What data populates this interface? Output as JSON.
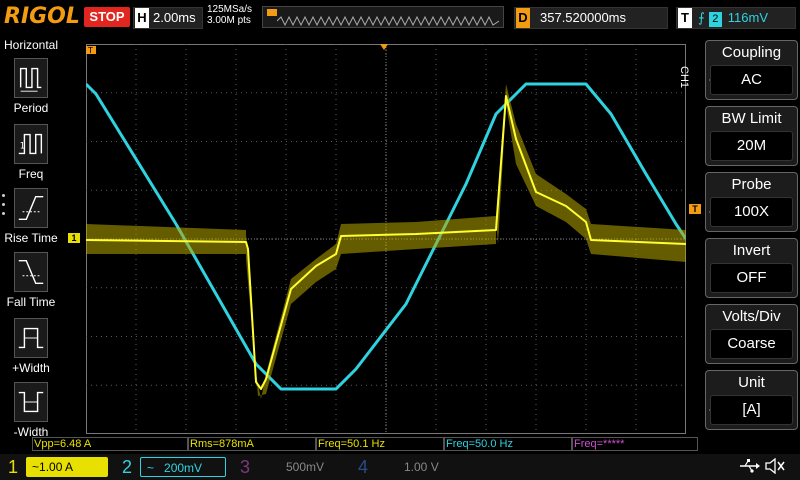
{
  "brand": {
    "logo": "RIGOL"
  },
  "topbar": {
    "run_state": "STOP",
    "horizontal_letter": "H",
    "timebase": "2.00ms",
    "sample_rate": "125MSa/s",
    "mem_depth": "3.00M pts",
    "delay_letter": "D",
    "delay_value": "357.520000ms",
    "trigger_letter": "T",
    "trigger_slope_icon": "rising-edge-icon",
    "trigger_source": "2",
    "trigger_level": "116mV"
  },
  "left_panel": {
    "title": "Horizontal",
    "items": [
      {
        "label": "Period",
        "icon": "period-measure-icon"
      },
      {
        "label": "Freq",
        "icon": "freq-measure-icon"
      },
      {
        "label": "Rise Time",
        "icon": "rise-time-icon"
      },
      {
        "label": "Fall Time",
        "icon": "fall-time-icon"
      },
      {
        "label": "+Width",
        "icon": "positive-width-icon"
      },
      {
        "label": "-Width",
        "icon": "negative-width-icon"
      }
    ]
  },
  "markers": {
    "ch1_level": "1",
    "trigger_marker": "T",
    "trigger_pos_marker": "T"
  },
  "right_menu": {
    "channel_tag": "CH1",
    "items": [
      {
        "title": "Coupling",
        "value": "AC",
        "has_arrow": true
      },
      {
        "title": "BW Limit",
        "value": "20M",
        "has_arrow": false
      },
      {
        "title": "Probe",
        "value": "100X",
        "has_arrow": true
      },
      {
        "title": "Invert",
        "value": "OFF",
        "has_arrow": false
      },
      {
        "title": "Volts/Div",
        "value": "Coarse",
        "has_arrow": false
      },
      {
        "title": "Unit",
        "value": "[A]",
        "has_arrow": true
      }
    ]
  },
  "measurements": [
    {
      "text": "Vpp=6.48 A",
      "color": "#e8e000"
    },
    {
      "text": "Rms=878mA",
      "color": "#e8e000"
    },
    {
      "text": "Freq=50.1 Hz",
      "color": "#e8e000"
    },
    {
      "text": "Freq=50.0 Hz",
      "color": "#2fd3e0"
    },
    {
      "text": "Freq=*****",
      "color": "#d050d0"
    }
  ],
  "channels": [
    {
      "num": "1",
      "coupling_icon": "ac-coupling-icon",
      "scale": "1.00 A",
      "color": "#e8e000",
      "active": true
    },
    {
      "num": "2",
      "coupling_icon": "ac-coupling-icon",
      "scale": "200mV",
      "color": "#2fd3e0",
      "active": true
    },
    {
      "num": "3",
      "coupling_icon": "",
      "scale": "500mV",
      "color": "#d050d0",
      "active": false
    },
    {
      "num": "4",
      "coupling_icon": "",
      "scale": "1.00 V",
      "color": "#3a6ad0",
      "active": false
    }
  ],
  "status_icons": [
    "usb-icon",
    "speaker-muted-icon"
  ],
  "colors": {
    "ch1": "#e8e000",
    "ch2": "#2fd3e0",
    "ch3": "#d050d0",
    "ch4": "#3a6ad0",
    "accent": "#f39c12",
    "stop": "#e0261e"
  }
}
